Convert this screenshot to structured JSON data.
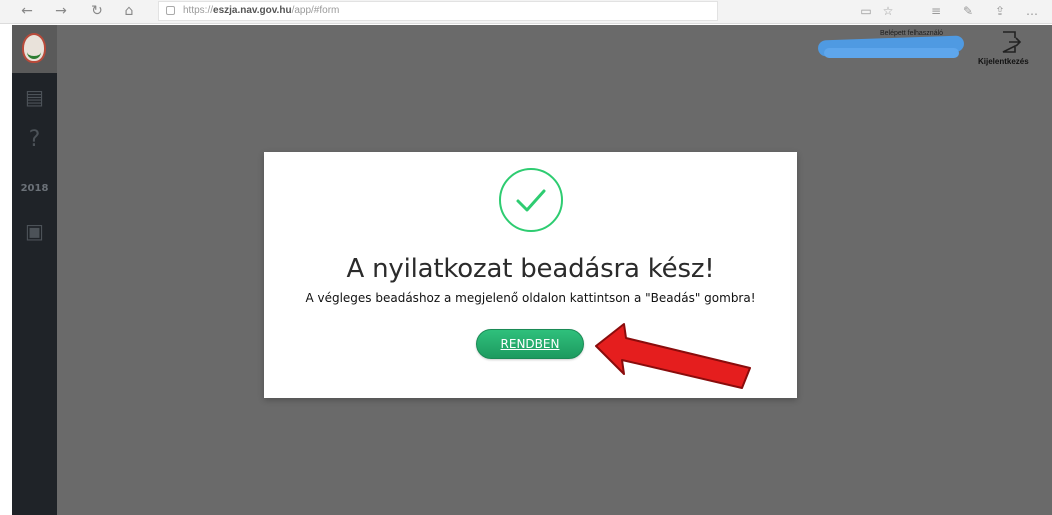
{
  "browser": {
    "back_icon": "←",
    "forward_icon": "→",
    "refresh_icon": "↻",
    "home_icon": "⌂",
    "url_domain": "eszja.nav.gov.hu",
    "url_prefix": "https://",
    "url_suffix": "/app/#form"
  },
  "header": {
    "user_label": "Belépett felhasználó",
    "logout_label": "Kijelentkezés"
  },
  "sidebar": {
    "items": [
      {
        "icon": "form-icon",
        "glyph": "▤"
      },
      {
        "icon": "help-icon",
        "glyph": "?"
      },
      {
        "icon": "calendar-2018-icon",
        "glyph": "2018"
      },
      {
        "icon": "document-icon",
        "glyph": "▣"
      }
    ]
  },
  "modal": {
    "title": "A nyilatkozat beadásra kész!",
    "subtitle": "A végleges beadáshoz a megjelenő oldalon kattintson a \"Beadás\" gombra!",
    "ok_label": "RENDBEN"
  },
  "colors": {
    "success_green": "#2ecc71",
    "button_green": "#1d9a5f",
    "arrow_red": "#e51e1e",
    "overlay_gray": "#6a6a6a",
    "scribble_blue": "#4f9ae2"
  }
}
